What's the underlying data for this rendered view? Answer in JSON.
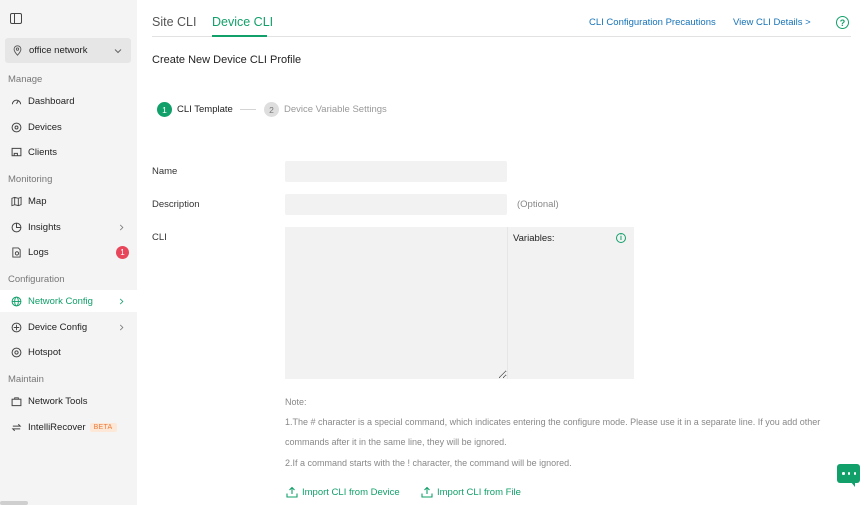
{
  "sidebar": {
    "site_name": "office network",
    "sections": {
      "manage": "Manage",
      "monitoring": "Monitoring",
      "configuration": "Configuration",
      "maintain": "Maintain"
    },
    "items": {
      "dashboard": "Dashboard",
      "devices": "Devices",
      "clients": "Clients",
      "map": "Map",
      "insights": "Insights",
      "logs": "Logs",
      "logs_badge": "1",
      "network_config": "Network Config",
      "device_config": "Device Config",
      "hotspot": "Hotspot",
      "network_tools": "Network Tools",
      "intellirecover": "IntelliRecover",
      "beta": "BETA"
    }
  },
  "header": {
    "tabs": [
      "Site CLI",
      "Device CLI"
    ],
    "active_tab": "Device CLI",
    "precautions_link": "CLI Configuration Precautions",
    "details_link": "View CLI Details >",
    "help_icon": "?"
  },
  "page": {
    "title": "Create New Device CLI Profile",
    "steps": [
      {
        "num": "1",
        "label": "CLI Template"
      },
      {
        "num": "2",
        "label": "Device Variable Settings"
      }
    ],
    "form": {
      "name_label": "Name",
      "name_value": "",
      "description_label": "Description",
      "description_value": "",
      "optional_text": "(Optional)",
      "cli_label": "CLI",
      "cli_value": "",
      "variables_label": "Variables:",
      "info_icon": "i"
    },
    "note": {
      "title": "Note:",
      "line1": "1.The # character is a special command, which indicates entering the configure mode. Please use it in a separate line. If you add other",
      "line2": "commands after it in the same line, they will be ignored.",
      "line3": "2.If a command starts with the ! character, the command will be ignored."
    },
    "import_device": "Import CLI from Device",
    "import_file": "Import CLI from File"
  },
  "colors": {
    "accent": "#12a06a",
    "link": "#1673b8",
    "badge": "#e8465a"
  }
}
